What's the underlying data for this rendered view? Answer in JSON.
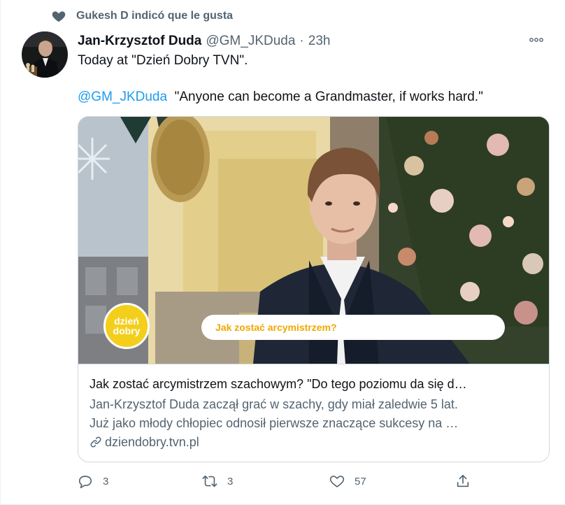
{
  "social_context": {
    "text": "Gukesh D indicó que le gusta"
  },
  "author": {
    "name": "Jan-Krzysztof Duda",
    "handle": "@GM_JKDuda",
    "separator": "·",
    "time": "23h"
  },
  "tweet": {
    "line1": "Today at \"Dzień Dobry TVN\".",
    "mention": "@GM_JKDuda",
    "quote": "\"Anyone can become a Grandmaster, if works hard.\""
  },
  "card": {
    "media": {
      "logo_line1": "dzień",
      "logo_line2": "dobry",
      "lower_third": "Jak zostać arcymistrzem?"
    },
    "title": "Jak zostać arcymistrzem szachowym? \"Do tego poziomu da się d…",
    "description_line1": "Jan-Krzysztof Duda zaczął grać w szachy, gdy miał zaledwie 5 lat.",
    "description_line2": "Już jako młody chłopiec odnosił pierwsze znaczące sukcesy na …",
    "domain": "dziendobry.tvn.pl"
  },
  "actions": {
    "reply_count": "3",
    "retweet_count": "3",
    "like_count": "57"
  },
  "icons": {
    "like": "heart-icon",
    "more": "more-icon",
    "link": "link-icon",
    "reply": "reply-icon",
    "retweet": "retweet-icon",
    "share": "share-icon"
  },
  "colors": {
    "accent": "#1d9bf0",
    "muted": "#536471",
    "text": "#0f1419",
    "border": "#cfd9de",
    "logo_yellow": "#f3cf1c",
    "lower_third_text": "#f0a800"
  }
}
